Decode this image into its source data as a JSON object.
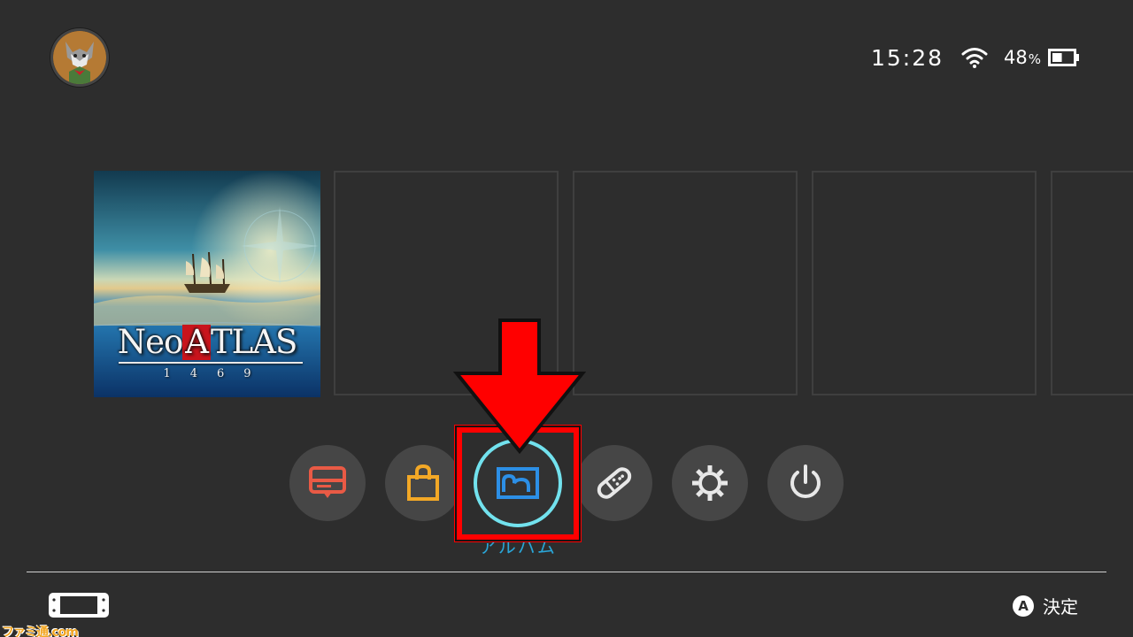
{
  "status_bar": {
    "time": "15:28",
    "battery_percent": "48",
    "battery_unit": "%",
    "battery_level": 0.48,
    "icons": [
      "wifi-icon",
      "battery-icon"
    ]
  },
  "game_tiles": [
    {
      "title": "Neo ATLAS 1469",
      "logo_left": "Neo",
      "logo_boxed": "A",
      "logo_right": "TLAS",
      "logo_year": "1469"
    }
  ],
  "empty_tile_count": 4,
  "menu": {
    "items": [
      {
        "name": "news",
        "icon": "news-icon",
        "color": "#e95a45"
      },
      {
        "name": "shop",
        "icon": "shop-bag-icon",
        "color": "#f3a826"
      },
      {
        "name": "album",
        "icon": "album-icon",
        "color": "#2c8fe6",
        "selected": true
      },
      {
        "name": "controllers",
        "icon": "controller-icon",
        "color": "#e8e8e8"
      },
      {
        "name": "settings",
        "icon": "gear-icon",
        "color": "#e8e8e8"
      },
      {
        "name": "sleep",
        "icon": "power-icon",
        "color": "#e8e8e8"
      }
    ],
    "selected_label": "アルバム",
    "highlight_color": "#72e2ee"
  },
  "annotation": {
    "arrow_color": "#ff0000"
  },
  "footer": {
    "a_button": "A",
    "action_label": "決定",
    "console_icon": "console-icon"
  },
  "watermark": "ファミ通.com"
}
